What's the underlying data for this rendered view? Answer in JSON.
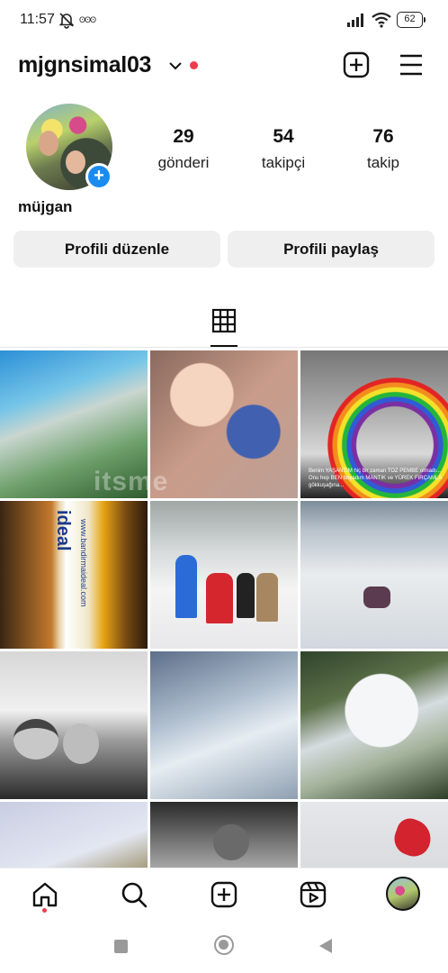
{
  "status_bar": {
    "time": "11:57",
    "notif_dots": "ʘʘʘ",
    "battery": "62"
  },
  "header": {
    "username": "mjgnsimal03",
    "icons": [
      "chevron-down-icon",
      "new-post-icon",
      "menu-icon"
    ],
    "notification_dot_color": "#ef3c4a"
  },
  "profile": {
    "display_name": "müjgan",
    "stats": [
      {
        "value": "29",
        "label": "gönderi"
      },
      {
        "value": "54",
        "label": "takipçi"
      },
      {
        "value": "76",
        "label": "takip"
      }
    ],
    "buttons": {
      "edit": "Profili düzenle",
      "share": "Profili paylaş"
    }
  },
  "grid": {
    "tab_icon": "grid-icon",
    "post_count_visible": 12,
    "tile_texts": {
      "brand": "ideal",
      "url": "www.bandirmaideal.com",
      "rainbow_caption": "Benim YAŞANTIM hiç bir zaman TOZ PEMBE olmadı... Onu hep BEN boyadım MANTIK ve YÜREK FIRÇAMLA gökkuşağına..."
    },
    "watermark": "itsme"
  },
  "bottom_nav": {
    "items": [
      "home-icon",
      "search-icon",
      "create-icon",
      "reels-icon",
      "profile-avatar"
    ],
    "accent": "#ef3c4a"
  },
  "colors": {
    "story_add_blue": "#1a8cf0",
    "button_bg": "#efefef"
  }
}
